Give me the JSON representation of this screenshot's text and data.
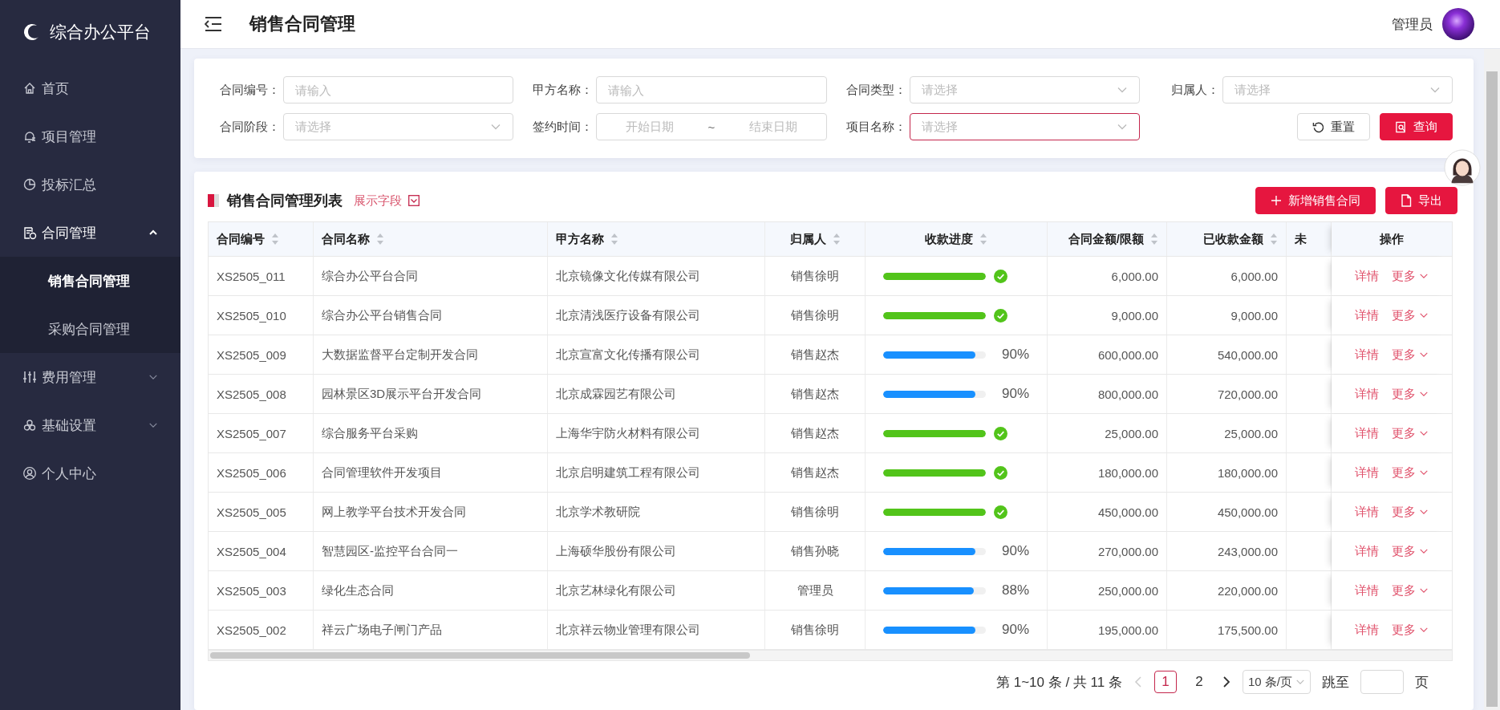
{
  "sidebar": {
    "logo": "综合办公平台",
    "items": [
      {
        "label": "首页",
        "selected": false
      },
      {
        "label": "项目管理",
        "selected": false
      },
      {
        "label": "投标汇总",
        "selected": false
      },
      {
        "label": "合同管理",
        "selected": true,
        "expanded": true,
        "children": [
          {
            "label": "销售合同管理",
            "selected": true
          },
          {
            "label": "采购合同管理",
            "selected": false
          }
        ]
      },
      {
        "label": "费用管理",
        "selected": false,
        "expanded": false
      },
      {
        "label": "基础设置",
        "selected": false,
        "expanded": false
      },
      {
        "label": "个人中心",
        "selected": false
      }
    ]
  },
  "header": {
    "title": "销售合同管理",
    "user": "管理员"
  },
  "filters": [
    {
      "kind": "input",
      "label": "合同编号：",
      "placeholder": "请输入",
      "focused": false
    },
    {
      "kind": "input",
      "label": "甲方名称：",
      "placeholder": "请输入",
      "focused": false
    },
    {
      "kind": "select",
      "label": "合同类型：",
      "placeholder": "请选择",
      "focused": false
    },
    {
      "kind": "select",
      "label": "归属人：",
      "placeholder": "请选择",
      "focused": false
    },
    {
      "kind": "select",
      "label": "合同阶段：",
      "placeholder": "请选择",
      "focused": false
    },
    {
      "kind": "daterange",
      "label": "签约时间：",
      "start_placeholder": "开始日期",
      "separator": "~",
      "end_placeholder": "结束日期",
      "focused": false
    },
    {
      "kind": "select",
      "label": "项目名称：",
      "placeholder": "请选择",
      "focused": true
    }
  ],
  "filter_buttons": [
    {
      "kind": "reset",
      "label": "重置"
    },
    {
      "kind": "search",
      "label": "查询"
    }
  ],
  "list": {
    "title": "销售合同管理列表",
    "field_toggle": "展示字段",
    "actions": [
      {
        "kind": "add",
        "label": "新增销售合同"
      },
      {
        "kind": "export",
        "label": "导出"
      }
    ]
  },
  "table": {
    "columns": [
      {
        "label": "合同编号",
        "sortable": true
      },
      {
        "label": "合同名称",
        "sortable": true
      },
      {
        "label": "甲方名称",
        "sortable": true
      },
      {
        "label": "归属人",
        "sortable": true
      },
      {
        "label": "收款进度",
        "sortable": true
      },
      {
        "label": "合同金额/限额",
        "sortable": true
      },
      {
        "label": "已收款金额",
        "sortable": true
      },
      {
        "label": "未",
        "sortable": false
      },
      {
        "label": "操作",
        "sortable": false
      }
    ],
    "rows": [
      {
        "id": "XS2505_011",
        "name": "综合办公平台合同",
        "party": "北京镜像文化传媒有限公司",
        "owner": "销售徐明",
        "progress": {
          "level": 1,
          "complete": true
        },
        "amount": "6,000.00",
        "received": "6,000.00",
        "actions": [
          "详情",
          "更多"
        ]
      },
      {
        "id": "XS2505_010",
        "name": "综合办公平台销售合同",
        "party": "北京清浅医疗设备有限公司",
        "owner": "销售徐明",
        "progress": {
          "level": 1,
          "complete": true
        },
        "amount": "9,000.00",
        "received": "9,000.00",
        "actions": [
          "详情",
          "更多"
        ]
      },
      {
        "id": "XS2505_009",
        "name": "大数据监督平台定制开发合同",
        "party": "北京宣富文化传播有限公司",
        "owner": "销售赵杰",
        "progress": {
          "level": 0.9,
          "complete": false,
          "reading": "90%"
        },
        "amount": "600,000.00",
        "received": "540,000.00",
        "actions": [
          "详情",
          "更多"
        ]
      },
      {
        "id": "XS2505_008",
        "name": "园林景区3D展示平台开发合同",
        "party": "北京成霖园艺有限公司",
        "owner": "销售赵杰",
        "progress": {
          "level": 0.9,
          "complete": false,
          "reading": "90%"
        },
        "amount": "800,000.00",
        "received": "720,000.00",
        "actions": [
          "详情",
          "更多"
        ]
      },
      {
        "id": "XS2505_007",
        "name": "综合服务平台采购",
        "party": "上海华宇防火材料有限公司",
        "owner": "销售赵杰",
        "progress": {
          "level": 1,
          "complete": true
        },
        "amount": "25,000.00",
        "received": "25,000.00",
        "actions": [
          "详情",
          "更多"
        ]
      },
      {
        "id": "XS2505_006",
        "name": "合同管理软件开发项目",
        "party": "北京启明建筑工程有限公司",
        "owner": "销售赵杰",
        "progress": {
          "level": 1,
          "complete": true
        },
        "amount": "180,000.00",
        "received": "180,000.00",
        "actions": [
          "详情",
          "更多"
        ]
      },
      {
        "id": "XS2505_005",
        "name": "网上教学平台技术开发合同",
        "party": "北京学术教研院",
        "owner": "销售徐明",
        "progress": {
          "level": 1,
          "complete": true
        },
        "amount": "450,000.00",
        "received": "450,000.00",
        "actions": [
          "详情",
          "更多"
        ]
      },
      {
        "id": "XS2505_004",
        "name": "智慧园区-监控平台合同一",
        "party": "上海硕华股份有限公司",
        "owner": "销售孙晓",
        "progress": {
          "level": 0.9,
          "complete": false,
          "reading": "90%"
        },
        "amount": "270,000.00",
        "received": "243,000.00",
        "actions": [
          "详情",
          "更多"
        ]
      },
      {
        "id": "XS2505_003",
        "name": "绿化生态合同",
        "party": "北京艺林绿化有限公司",
        "owner": "管理员",
        "progress": {
          "level": 0.88,
          "complete": false,
          "reading": "88%"
        },
        "amount": "250,000.00",
        "received": "220,000.00",
        "actions": [
          "详情",
          "更多"
        ]
      },
      {
        "id": "XS2505_002",
        "name": "祥云广场电子闸门产品",
        "party": "北京祥云物业管理有限公司",
        "owner": "销售徐明",
        "progress": {
          "level": 0.9,
          "complete": false,
          "reading": "90%"
        },
        "amount": "195,000.00",
        "received": "175,500.00",
        "actions": [
          "详情",
          "更多"
        ]
      }
    ]
  },
  "pagination": {
    "summary": "第 1~10 条 / 共 11 条",
    "prev_disabled": true,
    "pages": [
      {
        "label": "1",
        "selected": true
      },
      {
        "label": "2",
        "selected": false
      }
    ],
    "page_size": "10 条/页",
    "jump_label": "跳至",
    "page_unit": "页"
  }
}
